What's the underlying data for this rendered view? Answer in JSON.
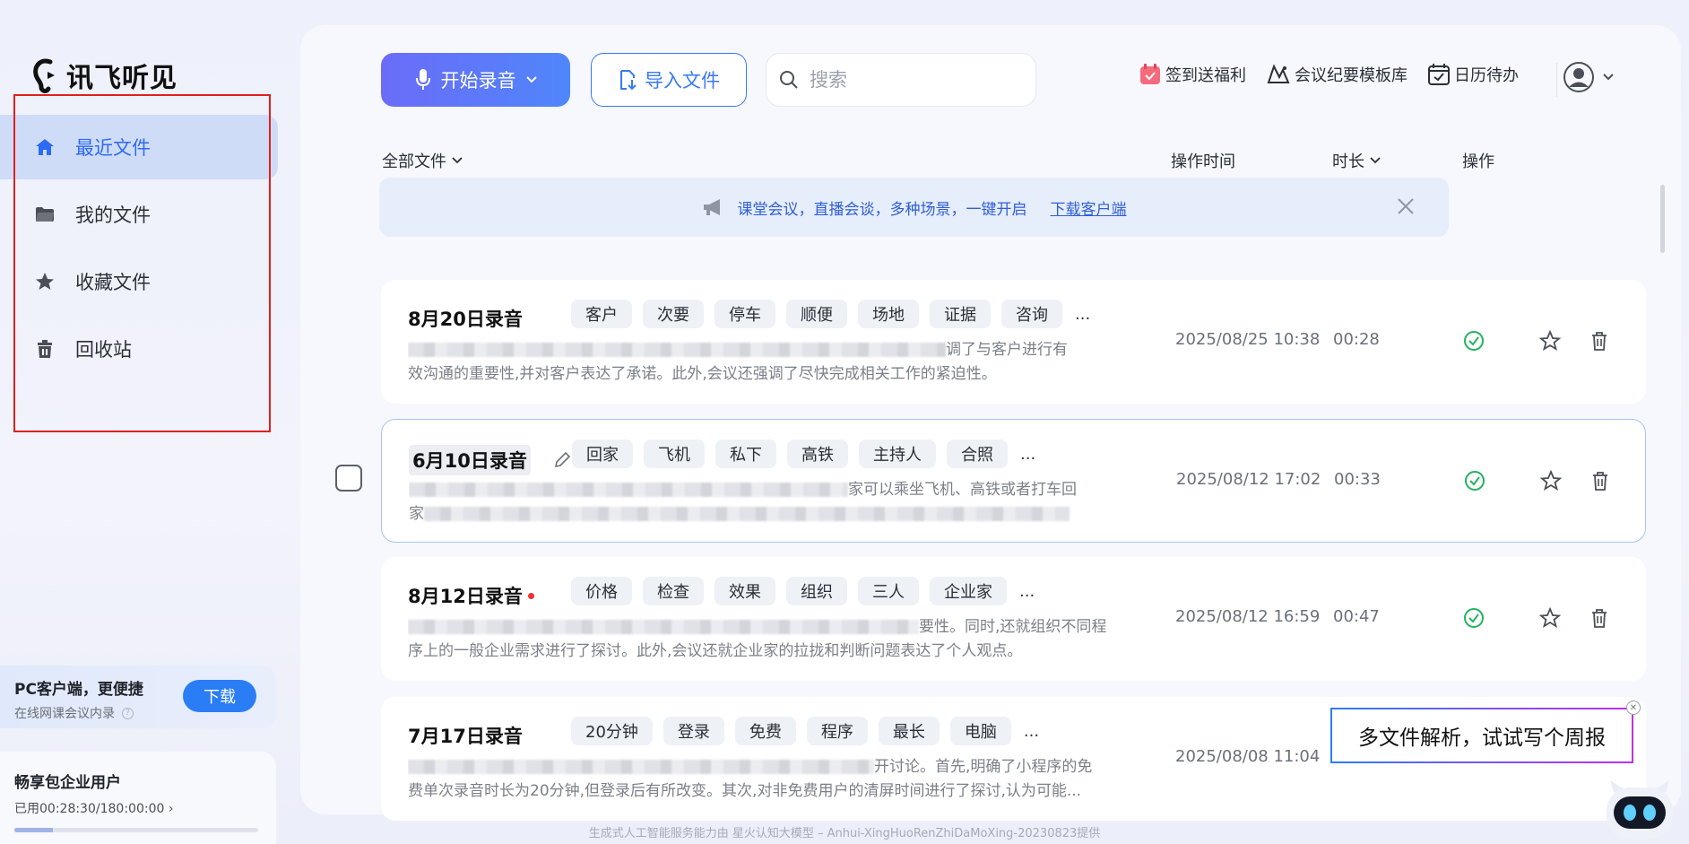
{
  "app": {
    "logo_text": "讯飞听见"
  },
  "sidebar": {
    "items": [
      {
        "label": "最近文件",
        "icon": "home-icon",
        "active": true
      },
      {
        "label": "我的文件",
        "icon": "folder-icon",
        "active": false
      },
      {
        "label": "收藏文件",
        "icon": "star-icon",
        "active": false
      },
      {
        "label": "回收站",
        "icon": "trash-icon",
        "active": false
      }
    ],
    "pc_card": {
      "title": "PC客户端，更便捷",
      "subtitle": "在线网课会议内录",
      "button": "下载"
    },
    "vip_card": {
      "title": "畅享包企业用户",
      "usage": "已用00:28:30/180:00:00",
      "usage_fraction": 0.158
    }
  },
  "toolbar": {
    "record_label": "开始录音",
    "import_label": "导入文件",
    "search_placeholder": "搜索",
    "links": [
      {
        "label": "签到送福利",
        "icon": "gift-calendar-icon"
      },
      {
        "label": "会议纪要模板库",
        "icon": "template-icon"
      },
      {
        "label": "日历待办",
        "icon": "calendar-check-icon"
      }
    ]
  },
  "list_header": {
    "filter": "全部文件",
    "time": "操作时间",
    "duration": "时长",
    "action": "操作"
  },
  "banner": {
    "text": "课堂会议，直播会谈，多种场景，一键开启",
    "link": "下载客户端"
  },
  "files": [
    {
      "title": "8月20日录音",
      "tags": [
        "客户",
        "次要",
        "停车",
        "顺便",
        "场地",
        "证据",
        "咨询"
      ],
      "summary_line1_visible": "调了与客户进行有",
      "summary_line2": "效沟通的重要性,并对客户表达了承诺。此外,会议还强调了尽快完成相关工作的紧迫性。",
      "time": "2025/08/25 10:38",
      "duration": "00:28",
      "status": "done"
    },
    {
      "title": "6月10日录音",
      "tags": [
        "回家",
        "飞机",
        "私下",
        "高铁",
        "主持人",
        "合照"
      ],
      "summary_line1_visible": "家可以乘坐飞机、高铁或者打车回",
      "summary_line2": "家",
      "time": "2025/08/12 17:02",
      "duration": "00:33",
      "status": "done"
    },
    {
      "title": "8月12日录音",
      "tags": [
        "价格",
        "检查",
        "效果",
        "组织",
        "三人",
        "企业家"
      ],
      "summary_line1_visible": "要性。同时,还就组织不同程",
      "summary_line2": "序上的一般企业需求进行了探讨。此外,会议还就企业家的拉拢和判断问题表达了个人观点。",
      "time": "2025/08/12 16:59",
      "duration": "00:47",
      "status": "done"
    },
    {
      "title": "7月17日录音",
      "tags": [
        "20分钟",
        "登录",
        "免费",
        "程序",
        "最长",
        "电脑"
      ],
      "summary_line1_visible": "开讨论。首先,明确了小程序的免",
      "summary_line2": "费单次录音时长为20分钟,但登录后有所改变。其次,对非免费用户的清屏时间进行了探讨,认为可能...",
      "time": "2025/08/08 11:04",
      "duration": "",
      "status": ""
    }
  ],
  "tooltip": {
    "text": "多文件解析，试试写个周报"
  },
  "footer": {
    "text": "生成式人工智能服务能力由 星火认知大模型 – Anhui-XingHuoRenZhiDaMoXing-20230823提供"
  },
  "colors": {
    "accent": "#2d6af6",
    "success": "#22b35e",
    "highlight_box": "#e11f1f"
  }
}
